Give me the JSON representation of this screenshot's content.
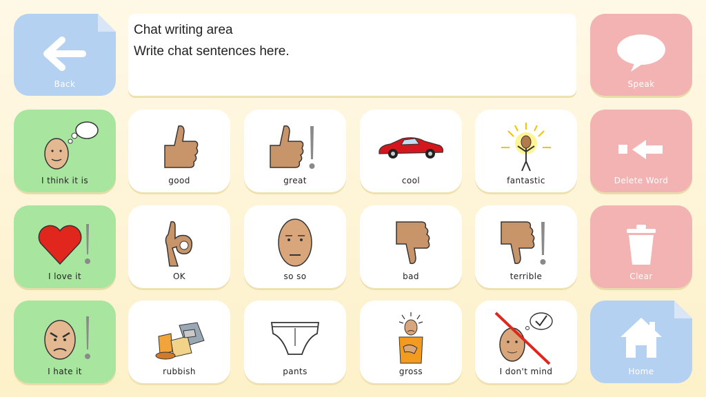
{
  "chat": {
    "line1": "Chat writing area",
    "line2": "Write chat sentences here."
  },
  "controls": {
    "back": "Back",
    "speak": "Speak",
    "delete_word": "Delete Word",
    "clear": "Clear",
    "home": "Home"
  },
  "phrases": [
    "I think it is",
    "I love it",
    "I hate it"
  ],
  "words": [
    [
      "good",
      "great",
      "cool",
      "fantastic"
    ],
    [
      "OK",
      "so so",
      "bad",
      "terrible"
    ],
    [
      "rubbish",
      "pants",
      "gross",
      "I don't mind"
    ]
  ],
  "icons": {
    "back": "arrow-left-icon",
    "speak": "speech-bubble-icon",
    "delete_word": "backspace-arrow-icon",
    "clear": "trash-bin-icon",
    "home": "house-icon",
    "phrases": [
      "thinking-face-icon",
      "heart-exclamation-icon",
      "angry-face-icon"
    ],
    "words": [
      [
        "thumbs-up-icon",
        "thumbs-up-exclamation-icon",
        "red-car-icon",
        "shining-person-icon"
      ],
      [
        "ok-hand-icon",
        "neutral-face-icon",
        "thumbs-down-icon",
        "thumbs-down-exclamation-icon"
      ],
      [
        "rubbish-pile-icon",
        "underpants-icon",
        "disgusted-person-icon",
        "dont-mind-icon"
      ]
    ]
  },
  "colors": {
    "nav_blue": "#b4d1f2",
    "action_red": "#f4b3b3",
    "phrase_green": "#a8e6a0",
    "word_white": "#ffffff",
    "background": "#fdf1c9"
  }
}
